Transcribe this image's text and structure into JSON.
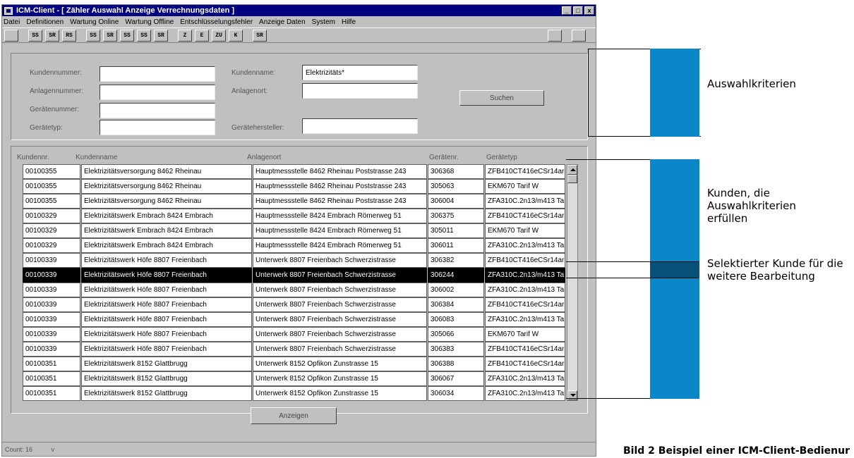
{
  "window": {
    "title": "ICM-Client - [ Zähler Auswahl  Anzeige Verrechnungsdaten ]",
    "min_label": "_",
    "max_label": "□",
    "close_label": "x"
  },
  "menu": [
    "Datei",
    "Definitionen",
    "Wartung Online",
    "Wartung Offline",
    "Entschlüsselungsfehler",
    "Anzeige Daten",
    "System",
    "Hilfe"
  ],
  "toolbar": {
    "buttons": [
      "",
      "SS",
      "SR",
      "RS",
      "SS",
      "SR",
      "SS",
      "SS",
      "SR",
      "Z",
      "E",
      "ZU",
      "K",
      "SR"
    ],
    "right_buttons": [
      "",
      ""
    ]
  },
  "search": {
    "kundennummer_label": "Kundennummer:",
    "kundennummer_value": "",
    "anlagennummer_label": "Anlagennummer:",
    "anlagennummer_value": "",
    "geraetenummer_label": "Gerätenummer:",
    "geraetenummer_value": "",
    "geraetetyp_label": "Gerätetyp:",
    "geraetetyp_value": "",
    "kundenname_label": "Kundenname:",
    "kundenname_value": "Elektrizitäts*",
    "anlagenort_label": "Anlagenort:",
    "anlagenort_value": "",
    "geraetehersteller_label": "Gerätehersteller:",
    "geraetehersteller_value": "",
    "suchen_label": "Suchen"
  },
  "table": {
    "headers": [
      "Kundennr.",
      "Kundenname",
      "Anlagenort",
      "Gerätenr.",
      "Gerätetyp"
    ],
    "rows": [
      [
        "00100355",
        "Elektrizitätsversorgung 8462 Rheinau",
        "Hauptmessstelle 8462 Rheinau Poststrasse 243",
        "306368",
        "ZFB410CT416eCSr14ar"
      ],
      [
        "00100355",
        "Elektrizitätsversorgung 8462 Rheinau",
        "Hauptmessstelle 8462 Rheinau Poststrasse 243",
        "305063",
        "EKM670 Tarif W"
      ],
      [
        "00100355",
        "Elektrizitätsversorgung 8462 Rheinau",
        "Hauptmessstelle 8462 Rheinau Poststrasse 243",
        "306004",
        "ZFA310C.2n13/m413 Ta"
      ],
      [
        "00100329",
        "Elektrizitätswerk Embrach 8424 Embrach",
        "Hauptmessstelle 8424 Embrach Römerweg 51",
        "306375",
        "ZFB410CT416eCSr14ar"
      ],
      [
        "00100329",
        "Elektrizitätswerk Embrach 8424 Embrach",
        "Hauptmessstelle 8424 Embrach Römerweg 51",
        "305011",
        "EKM670 Tarif W"
      ],
      [
        "00100329",
        "Elektrizitätswerk Embrach 8424 Embrach",
        "Hauptmessstelle 8424 Embrach Römerweg 51",
        "306011",
        "ZFA310C.2n13/m413 Ta"
      ],
      [
        "00100339",
        "Elektrizitätswerk Höfe 8807 Freienbach",
        "Unterwerk 8807 Freienbach Schwerzistrasse",
        "306382",
        "ZFB410CT416eCSr14ar"
      ],
      [
        "00100339",
        "Elektrizitätswerk Höfe 8807 Freienbach",
        "Unterwerk 8807 Freienbach Schwerzistrasse",
        "306244",
        "ZFA310C.2n13/m413 Ta"
      ],
      [
        "00100339",
        "Elektrizitätswerk Höfe 8807 Freienbach",
        "Unterwerk 8807 Freienbach Schwerzistrasse",
        "306002",
        "ZFA310C.2n13/m413 Ta"
      ],
      [
        "00100339",
        "Elektrizitätswerk Höfe 8807 Freienbach",
        "Unterwerk 8807 Freienbach Schwerzistrasse",
        "306384",
        "ZFB410CT416eCSr14ar"
      ],
      [
        "00100339",
        "Elektrizitätswerk Höfe 8807 Freienbach",
        "Unterwerk 8807 Freienbach Schwerzistrasse",
        "306083",
        "ZFA310C.2n13/m413 Ta"
      ],
      [
        "00100339",
        "Elektrizitätswerk Höfe 8807 Freienbach",
        "Unterwerk 8807 Freienbach Schwerzistrasse",
        "305066",
        "EKM670 Tarif W"
      ],
      [
        "00100339",
        "Elektrizitätswerk Höfe 8807 Freienbach",
        "Unterwerk 8807 Freienbach Schwerzistrasse",
        "306383",
        "ZFB410CT416eCSr14ar"
      ],
      [
        "00100351",
        "Elektrizitätswerk 8152 Glattbrugg",
        "Unterwerk 8152 Opfikon Zunstrasse 15",
        "306388",
        "ZFB410CT416eCSr14ar"
      ],
      [
        "00100351",
        "Elektrizitätswerk 8152 Glattbrugg",
        "Unterwerk 8152 Opfikon Zunstrasse 15",
        "306067",
        "ZFA310C.2n13/m413 Ta"
      ],
      [
        "00100351",
        "Elektrizitätswerk 8152 Glattbrugg",
        "Unterwerk 8152 Opfikon Zunstrasse 15",
        "306034",
        "ZFA310C.2n13/m413 Ta"
      ]
    ],
    "selected_row": 7
  },
  "anzeigen_label": "Anzeigen",
  "status": {
    "count": "Count: 16",
    "extra": "v"
  },
  "annotations": {
    "criteria": "Auswahlkriterien",
    "customers_line1": "Kunden, die",
    "customers_line2": "Auswahlkriterien",
    "customers_line3": "erfüllen",
    "selected_line1": "Selektierter Kunde für die",
    "selected_line2": "weitere Bearbeitung",
    "bar_color": "#0a87c8"
  },
  "caption": "Bild 2   Beispiel einer ICM-Client-Bedienur"
}
